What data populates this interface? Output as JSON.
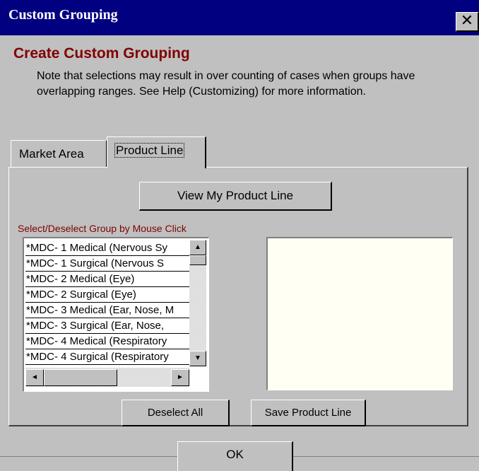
{
  "window": {
    "title": "Custom Grouping",
    "close_label": "✕"
  },
  "heading": "Create Custom Grouping",
  "note": "Note that selections may result in over counting of cases when groups have overlapping ranges.  See Help (Customizing) for more information.",
  "tabs": [
    {
      "label": "Market Area",
      "active": false
    },
    {
      "label": "Product Line",
      "active": true
    }
  ],
  "view_button": "View My Product Line",
  "select_label": "Select/Deselect Group by Mouse Click",
  "list_items": [
    "*MDC- 1 Medical (Nervous Sy",
    "*MDC- 1 Surgical (Nervous S",
    "*MDC- 2 Medical (Eye)",
    "*MDC- 2 Surgical (Eye)",
    "*MDC- 3 Medical (Ear, Nose, M",
    "*MDC- 3 Surgical (Ear, Nose, ",
    "*MDC- 4 Medical (Respiratory",
    "*MDC- 4 Surgical (Respiratory"
  ],
  "scroll_icons": {
    "up": "▲",
    "down": "▼",
    "left": "◄",
    "right": "►"
  },
  "deselect_button": "Deselect All",
  "save_button": "Save Product Line",
  "ok_button": "OK",
  "colors": {
    "titlebar": "#000080",
    "heading": "#800000",
    "face": "#c0c0c0",
    "textbox": "#fffff4"
  }
}
